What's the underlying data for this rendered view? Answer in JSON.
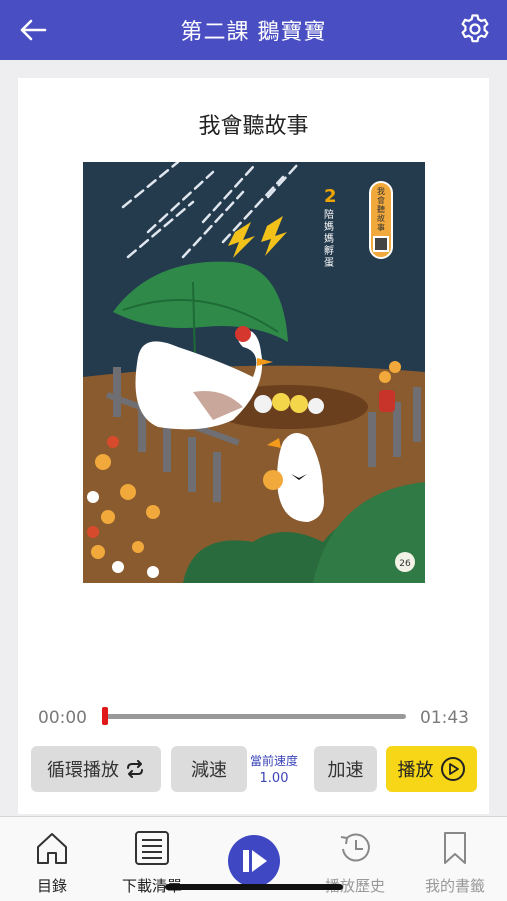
{
  "header": {
    "title": "第二課 鵝寶寶"
  },
  "card": {
    "story_title": "我會聽故事"
  },
  "illustration": {
    "book_number": "2",
    "book_title": "陪媽媽孵蛋",
    "badge": "我會聽故事",
    "page_number": "26"
  },
  "player": {
    "current_time": "00:00",
    "total_time": "01:43",
    "progress": 0.0
  },
  "controls": {
    "loop_label": "循環播放",
    "slow_label": "減速",
    "speed_label": "當前速度",
    "speed_value": "1.00",
    "fast_label": "加速",
    "play_label": "播放"
  },
  "tabs": {
    "toc": "目錄",
    "downloads": "下載清單",
    "history": "播放歷史",
    "bookmarks": "我的書籤"
  },
  "colors": {
    "header": "#4a4ec3",
    "play": "#f7d617",
    "accent": "#3a44b8",
    "progress_knob": "#e01818"
  }
}
